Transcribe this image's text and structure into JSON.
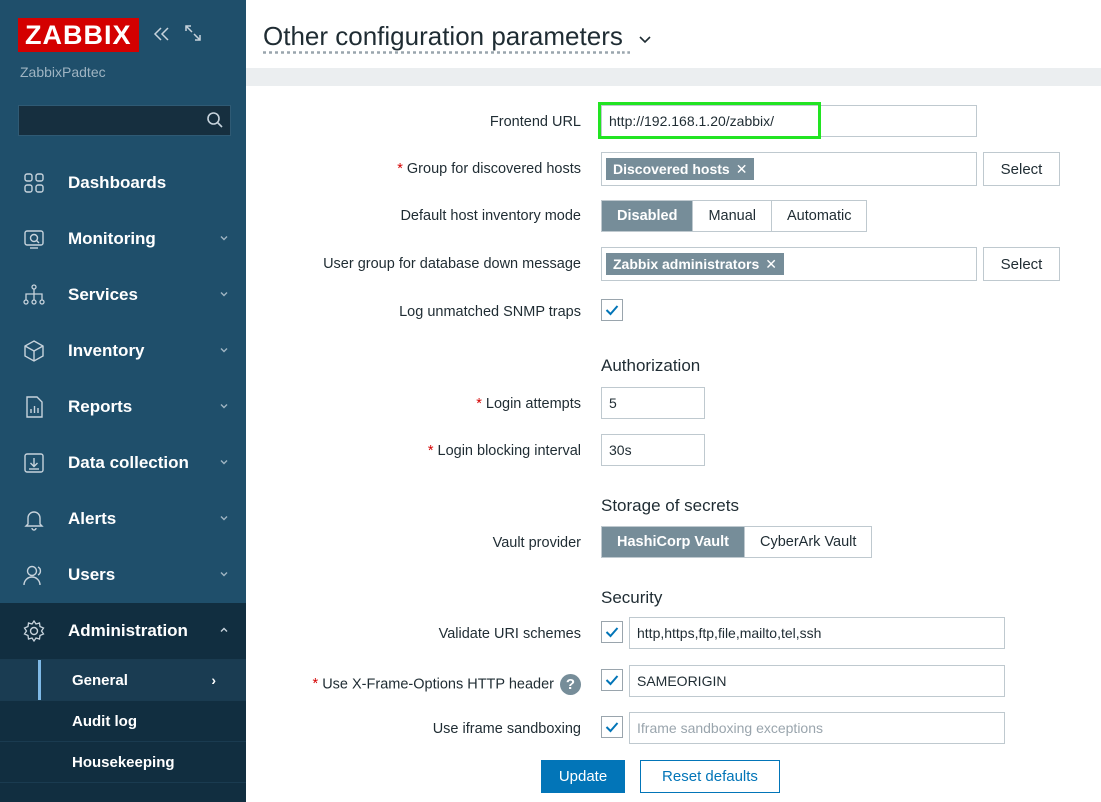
{
  "brand": {
    "logo": "ZABBIX",
    "server_name": "ZabbixPadtec"
  },
  "search": {
    "placeholder": "",
    "value": ""
  },
  "nav": {
    "dashboards": "Dashboards",
    "monitoring": "Monitoring",
    "services": "Services",
    "inventory": "Inventory",
    "reports": "Reports",
    "data_collection": "Data collection",
    "alerts": "Alerts",
    "users": "Users",
    "administration": "Administration"
  },
  "subnav": {
    "general": "General",
    "general_chev": "›",
    "audit_log": "Audit log",
    "housekeeping": "Housekeeping"
  },
  "page": {
    "title": "Other configuration parameters"
  },
  "form": {
    "frontend_url": {
      "label": "Frontend URL",
      "value": "http://192.168.1.20/zabbix/"
    },
    "group_discovered": {
      "required": "*",
      "label": "Group for discovered hosts",
      "chip": "Discovered hosts",
      "select_label": "Select"
    },
    "inventory_mode": {
      "label": "Default host inventory mode",
      "options": [
        "Disabled",
        "Manual",
        "Automatic"
      ],
      "selected": "Disabled"
    },
    "user_group_db_down": {
      "label": "User group for database down message",
      "chip": "Zabbix administrators",
      "select_label": "Select"
    },
    "log_snmp": {
      "label": "Log unmatched SNMP traps",
      "checked": true
    },
    "authorization": {
      "heading": "Authorization",
      "login_attempts": {
        "required": "*",
        "label": "Login attempts",
        "value": "5"
      },
      "login_blocking": {
        "required": "*",
        "label": "Login blocking interval",
        "value": "30s"
      }
    },
    "storage": {
      "heading": "Storage of secrets",
      "vault_provider": {
        "label": "Vault provider",
        "options": [
          "HashiCorp Vault",
          "CyberArk Vault"
        ],
        "selected": "HashiCorp Vault"
      }
    },
    "security": {
      "heading": "Security",
      "validate_uri": {
        "label": "Validate URI schemes",
        "checked": true,
        "value": "http,https,ftp,file,mailto,tel,ssh"
      },
      "x_frame": {
        "required": "*",
        "label": "Use X-Frame-Options HTTP header",
        "help": "?",
        "checked": true,
        "value": "SAMEORIGIN"
      },
      "iframe_sandbox": {
        "label": "Use iframe sandboxing",
        "checked": true,
        "placeholder": "Iframe sandboxing exceptions"
      }
    },
    "buttons": {
      "update": "Update",
      "reset": "Reset defaults"
    }
  },
  "colors": {
    "sidebar": "#1f4f6b",
    "logo": "#d40000",
    "primary": "#0275b8",
    "chip": "#768d99",
    "highlight": "#22e422"
  }
}
